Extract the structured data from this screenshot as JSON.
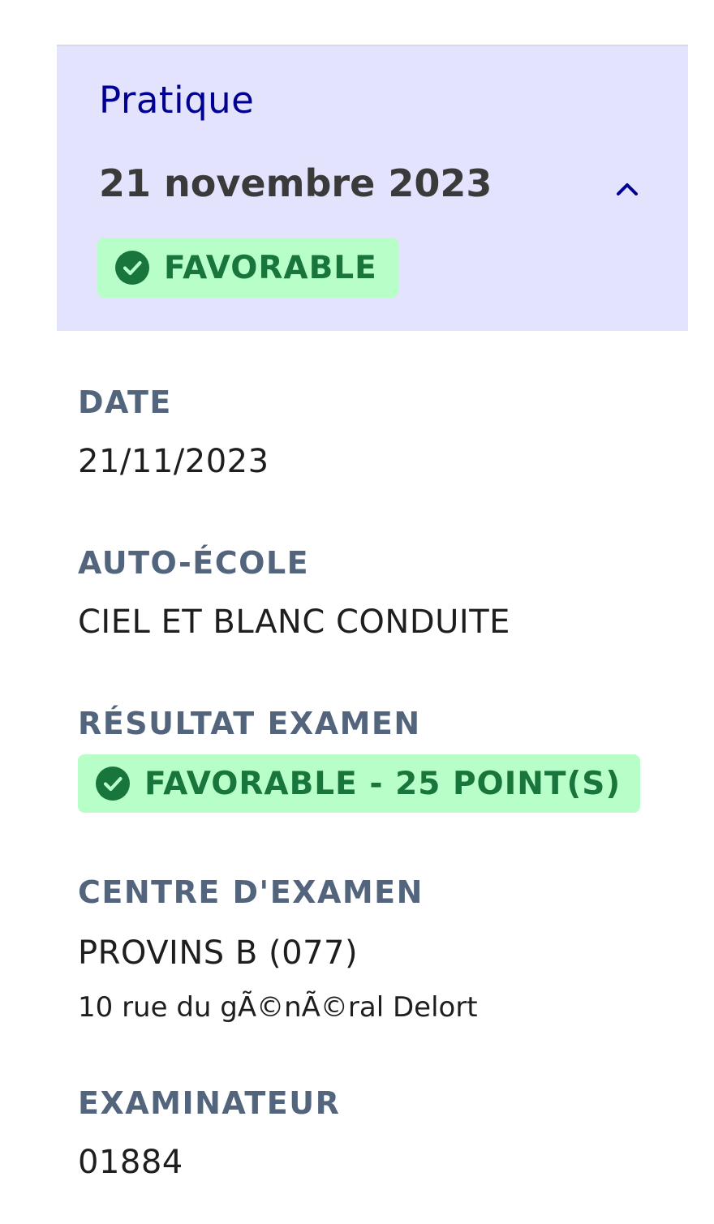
{
  "accordion": {
    "title": "Pratique",
    "date": "21 novembre 2023",
    "status_badge": "FAVORABLE",
    "expanded_icon": "chevron-up-icon"
  },
  "fields": {
    "date": {
      "label": "DATE",
      "value": "21/11/2023"
    },
    "auto_ecole": {
      "label": "AUTO-ÉCOLE",
      "value": "CIEL ET BLANC CONDUITE"
    },
    "resultat": {
      "label": "RÉSULTAT EXAMEN",
      "badge": "FAVORABLE - 25 POINT(S)"
    },
    "centre": {
      "label": "CENTRE D'EXAMEN",
      "value": "PROVINS B (077)",
      "address": "10 rue du gÃ©nÃ©ral Delort"
    },
    "examinateur": {
      "label": "EXAMINATEUR",
      "value": "01884"
    }
  },
  "colors": {
    "header_bg": "#e3e3fd",
    "title_blue": "#000091",
    "badge_bg": "#b8fec9",
    "badge_text": "#18753c",
    "label_grey": "#53657d"
  },
  "icons": {
    "badge_icon": "check-circle-icon"
  }
}
